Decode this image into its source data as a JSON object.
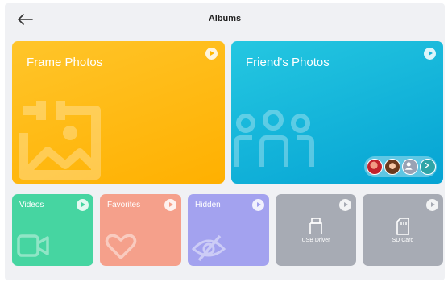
{
  "header": {
    "title": "Albums",
    "back_icon": "arrow-left-icon"
  },
  "albums": {
    "frame_photos": {
      "label": "Frame Photos",
      "color_top": "#ffc020",
      "color_bottom": "#ffb100",
      "icon": "photo-frame-icon"
    },
    "friends_photos": {
      "label": "Friend's Photos",
      "color_top": "#22c4df",
      "color_bottom": "#06a6d4",
      "icon": "people-group-icon"
    },
    "videos": {
      "label": "Videos",
      "color": "#45d6a2",
      "icon": "video-camera-icon"
    },
    "favorites": {
      "label": "Favorites",
      "color": "#f49c8a",
      "icon": "heart-icon"
    },
    "hidden": {
      "label": "Hidden",
      "color": "#a5a3ef",
      "icon": "eye-off-icon"
    },
    "usb_driver": {
      "label": "USB Driver",
      "color": "#a7abb4",
      "icon": "usb-icon"
    },
    "sd_card": {
      "label": "SD Card",
      "color": "#a7abb4",
      "icon": "sd-card-icon"
    }
  },
  "friends_avatars": {
    "avatar_1": "avatar-red-icon",
    "avatar_2": "avatar-brown-icon",
    "avatar_3": "avatar-placeholder-icon",
    "more": "chevron-right-icon"
  }
}
